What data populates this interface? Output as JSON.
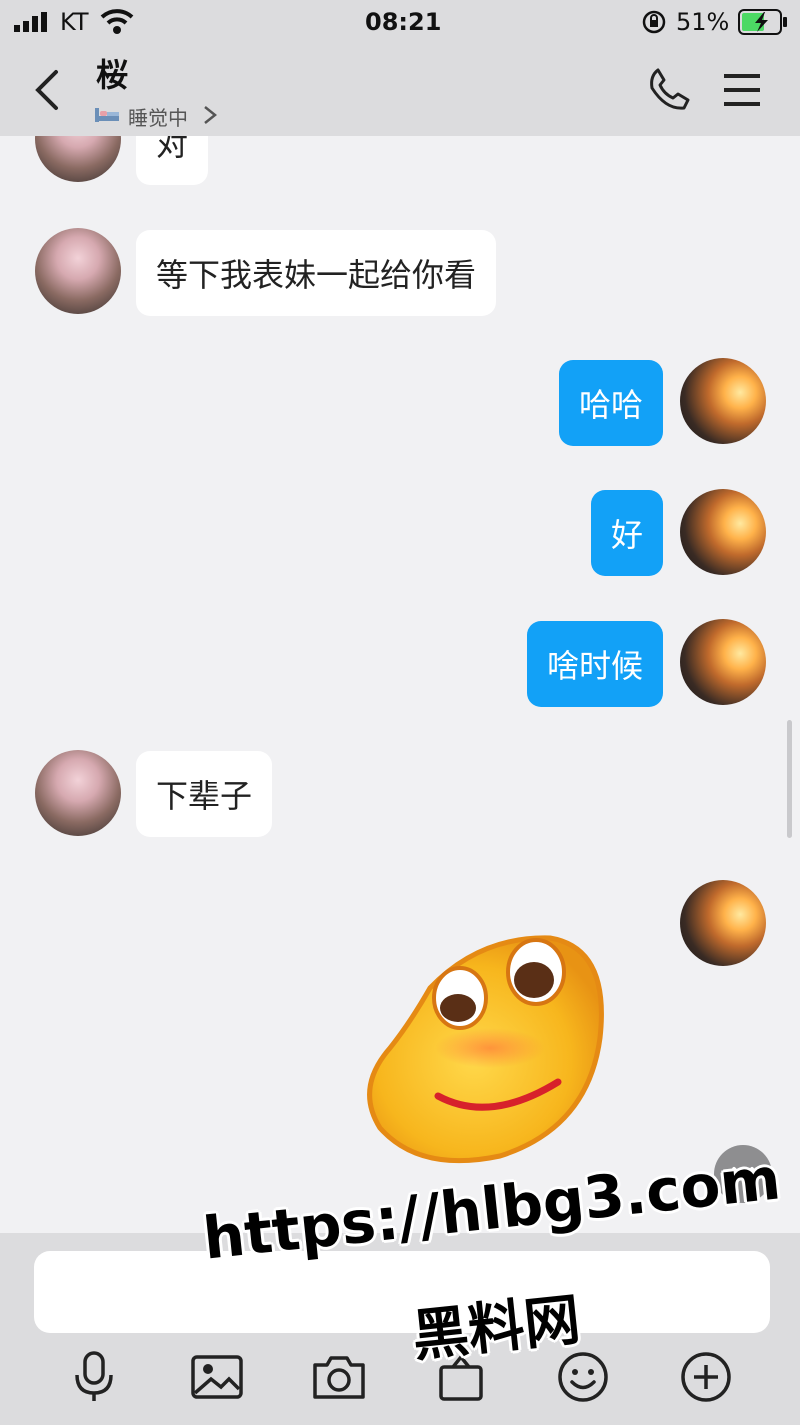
{
  "status_bar": {
    "carrier": "KT",
    "time": "08:21",
    "battery": "51%"
  },
  "header": {
    "title": "桜",
    "status": "睡觉中"
  },
  "messages": [
    {
      "side": "in",
      "text": "对"
    },
    {
      "side": "in",
      "text": "等下我表妹一起给你看"
    },
    {
      "side": "out",
      "text": "哈哈"
    },
    {
      "side": "out",
      "text": "好"
    },
    {
      "side": "out",
      "text": "啥时候"
    },
    {
      "side": "in",
      "text": "下辈子"
    },
    {
      "side": "out",
      "sticker": "smiling-blob-sticker"
    }
  ],
  "composer": {
    "placeholder": ""
  },
  "toolbar": {
    "icons": [
      "mic-icon",
      "image-icon",
      "camera-icon",
      "gift-icon",
      "emoji-icon",
      "plus-icon"
    ]
  },
  "watermark": {
    "url": "https://hlbg3.com",
    "name": "黑料网"
  },
  "colors": {
    "outgoing_bubble": "#12a1f7",
    "incoming_bubble": "#ffffff",
    "bars": "#dcdcde",
    "background": "#f1f1f3"
  }
}
